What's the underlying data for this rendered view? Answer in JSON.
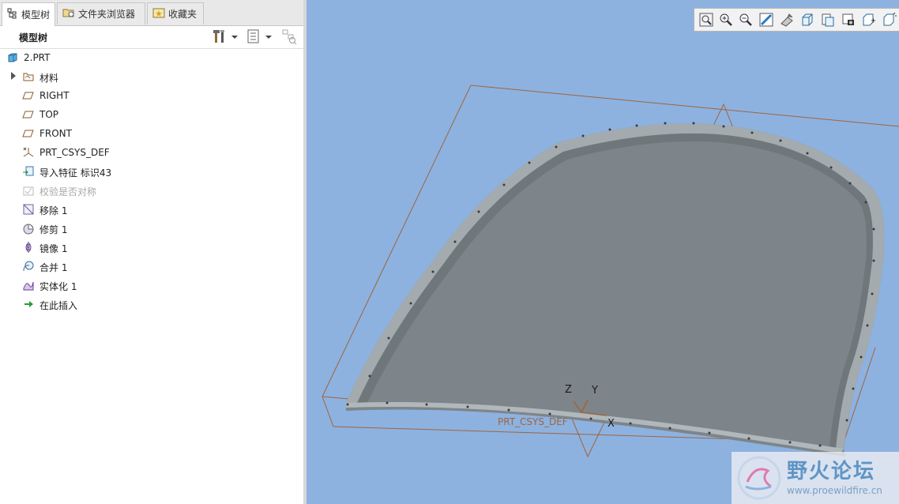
{
  "tabs": [
    {
      "label": "模型树",
      "active": true
    },
    {
      "label": "文件夹浏览器",
      "active": false
    },
    {
      "label": "收藏夹",
      "active": false
    }
  ],
  "tree_header": {
    "title": "模型树"
  },
  "tree": {
    "root": {
      "label": "2.PRT",
      "icon": "part-icon"
    },
    "items": [
      {
        "label": "材料",
        "icon": "material-icon",
        "expandable": true,
        "disabled": false
      },
      {
        "label": "RIGHT",
        "icon": "datum-plane-icon",
        "expandable": false,
        "disabled": false
      },
      {
        "label": "TOP",
        "icon": "datum-plane-icon",
        "expandable": false,
        "disabled": false
      },
      {
        "label": "FRONT",
        "icon": "datum-plane-icon",
        "expandable": false,
        "disabled": false
      },
      {
        "label": "PRT_CSYS_DEF",
        "icon": "csys-icon",
        "expandable": false,
        "disabled": false
      },
      {
        "label": "导入特征 标识43",
        "icon": "import-feature-icon",
        "expandable": false,
        "disabled": false
      },
      {
        "label": "校验是否对称",
        "icon": "check-icon",
        "expandable": false,
        "disabled": true
      },
      {
        "label": "移除 1",
        "icon": "remove-icon",
        "expandable": false,
        "disabled": false
      },
      {
        "label": "修剪 1",
        "icon": "trim-icon",
        "expandable": false,
        "disabled": false
      },
      {
        "label": "镜像 1",
        "icon": "mirror-icon",
        "expandable": false,
        "disabled": false
      },
      {
        "label": "合并 1",
        "icon": "merge-icon",
        "expandable": false,
        "disabled": false
      },
      {
        "label": "实体化 1",
        "icon": "solidify-icon",
        "expandable": false,
        "disabled": false
      },
      {
        "label": "在此插入",
        "icon": "insert-here-icon",
        "expandable": false,
        "disabled": false
      }
    ]
  },
  "view_toolbar": {
    "buttons": [
      "refit-icon",
      "zoom-in-icon",
      "zoom-out-icon",
      "repaint-icon",
      "display-style-icon",
      "saved-orientations-icon",
      "view-manager-icon",
      "datum-display-icon",
      "annotation-display-icon",
      "spin-center-icon"
    ]
  },
  "graphics": {
    "csys_label": "PRT_CSYS_DEF",
    "axis_x": "X",
    "axis_y": "Y",
    "axis_z": "Z"
  },
  "watermark": {
    "name": "野火论坛",
    "url": "www.proewildfire.cn"
  },
  "colors": {
    "background": "#8db2e0",
    "datum": "#a0643c",
    "model": "#9ea6aa"
  }
}
